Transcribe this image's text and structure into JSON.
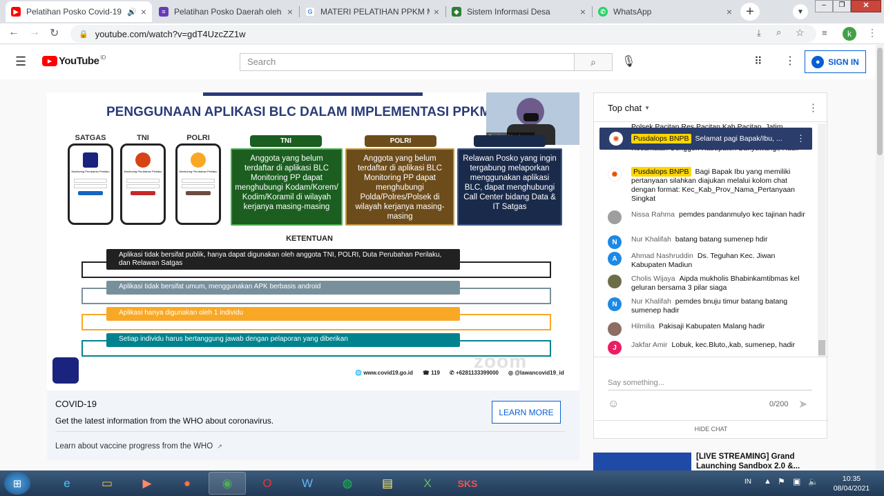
{
  "browser": {
    "tabs": [
      {
        "title": "Pelatihan Posko Covid-19",
        "icon_color": "#ff0000",
        "active": true
      },
      {
        "title": "Pelatihan Posko Daerah oleh S",
        "icon_color": "#673ab7"
      },
      {
        "title": "MATERI PELATIHAN PPKM MI",
        "icon_color": "#4285f4"
      },
      {
        "title": "Sistem Informasi Desa",
        "icon_color": "#2e7d32"
      },
      {
        "title": "WhatsApp",
        "icon_color": "#25d366"
      }
    ],
    "url": "youtube.com/watch?v=gdT4UzcZZ1w",
    "profile_initial": "k"
  },
  "youtube": {
    "logo_text": "YouTube",
    "logo_region": "ID",
    "search_placeholder": "Search",
    "sign_in_label": "SIGN IN"
  },
  "slide": {
    "title": "PENGGUNAAN APLIKASI BLC DALAM IMPLEMENTASI PPKM M",
    "phones": [
      {
        "label": "SATGAS",
        "app_title": "Monitoring Perubahan Perilaku"
      },
      {
        "label": "TNI",
        "app_title": "Monitoring Perubahan Perilaku"
      },
      {
        "label": "POLRI",
        "app_title": "Monitoring Perubahan Perilaku"
      }
    ],
    "boxes": [
      {
        "header": "TNI",
        "text": "Anggota yang belum terdaftar di aplikasi BLC Monitoring PP dapat menghubungi Kodam/Korem/ Kodim/Koramil di wilayah kerjanya masing-masing",
        "color": "#1b5e20",
        "header_color": "#1b5e20"
      },
      {
        "header": "POLRI",
        "text": "Anggota yang belum terdaftar di aplikasi BLC Monitoring PP dapat menghubungi Polda/Polres/Polsek di wilayah kerjanya masing-masing",
        "color": "#6d4c1b",
        "header_color": "#6d4c1b"
      },
      {
        "header": "",
        "text": "Relawan Posko yang ingin tergabung melaporkan menggunakan aplikasi BLC, dapat menghubungi Call Center bidang Data & IT Satgas",
        "color": "#1a2a4a",
        "header_color": "#1a2a4a"
      }
    ],
    "ketentuan_title": "KETENTUAN",
    "rules": [
      {
        "text": "Aplikasi tidak bersifat publik, hanya dapat digunakan oleh anggota TNI, POLRI, Duta Perubahan Perilaku, dan Relawan Satgas",
        "color": "#212121"
      },
      {
        "text": "Aplikasi tidak bersifat umum, menggunakan APK berbasis android",
        "color": "#78909c"
      },
      {
        "text": "Aplikasi hanya digunakan oleh 1 individu",
        "color": "#f9a825"
      },
      {
        "text": "Setiap individu harus bertanggung jawab dengan pelaporan yang diberikan",
        "color": "#00838f"
      }
    ],
    "footer": {
      "website": "www.covid19.go.id",
      "hotline": "119",
      "whatsapp": "+6281133399000",
      "social": "@lawancovid19_id"
    },
    "watermark": "zoom",
    "speaker_label": "Badan Nasion..."
  },
  "covid_panel": {
    "title": "COVID-19",
    "text": "Get the latest information from the WHO about coronavirus.",
    "button": "LEARN MORE",
    "link": "Learn about vaccine progress from the WHO"
  },
  "chat": {
    "header": "Top chat",
    "pinned": {
      "author": "Pusdalops BNPB",
      "text": "Selamat pagi Bapak/Ibu, ..."
    },
    "partial_top": "Polsek Pacitan Res Pacitan Kab Pacitan, Jatim",
    "partial_top2": "Kecamatan Conggeh Kabupaten Banyuwangi, Hadir",
    "messages": [
      {
        "author": "Pusdalops BNPB",
        "badge": true,
        "text": "Bagi Bapak Ibu yang memiliki pertanyaan silahkan diajukan melalui kolom chat dengan format: Kec_Kab_Prov_Nama_Pertanyaan Singkat",
        "avatar": "",
        "avatar_color": "#e65100"
      },
      {
        "author": "Nissa Rahma",
        "text": "pemdes pandanmulyo kec tajinan hadir",
        "avatar": "",
        "avatar_color": "#9e9e9e"
      },
      {
        "author": "Nur Khalifah",
        "text": "batang batang sumenep hdir",
        "avatar": "N",
        "avatar_color": "#1e88e5"
      },
      {
        "author": "Ahmad Nashruddin",
        "text": "Ds. Teguhan Kec. Jiwan Kabupaten Madiun",
        "avatar": "A",
        "avatar_color": "#1e88e5"
      },
      {
        "author": "Cholis Wijaya",
        "text": "Aipda mukholis Bhabinkamtibmas kel geluran bersama 3 pilar siaga",
        "avatar": "",
        "avatar_color": "#6d6d4a"
      },
      {
        "author": "Nur Khalifah",
        "text": "pemdes bnuju timur batang batang sumenep hadir",
        "avatar": "N",
        "avatar_color": "#1e88e5"
      },
      {
        "author": "Hilmilia",
        "text": "Pakisaji Kabupaten Malang hadir",
        "avatar": "",
        "avatar_color": "#8d6e63"
      },
      {
        "author": "Jakfar Amir",
        "text": "Lobuk, kec.Bluto,,kab, sumenep, hadir",
        "avatar": "J",
        "avatar_color": "#e91e63"
      }
    ],
    "input_placeholder": "Say something...",
    "counter": "0/200",
    "hide_chat": "HIDE CHAT"
  },
  "suggestion": {
    "title": "[LIVE STREAMING] Grand Launching Sandbox 2.0 &..."
  },
  "taskbar": {
    "lang": "IN",
    "time": "10:35",
    "date": "08/04/2021"
  }
}
